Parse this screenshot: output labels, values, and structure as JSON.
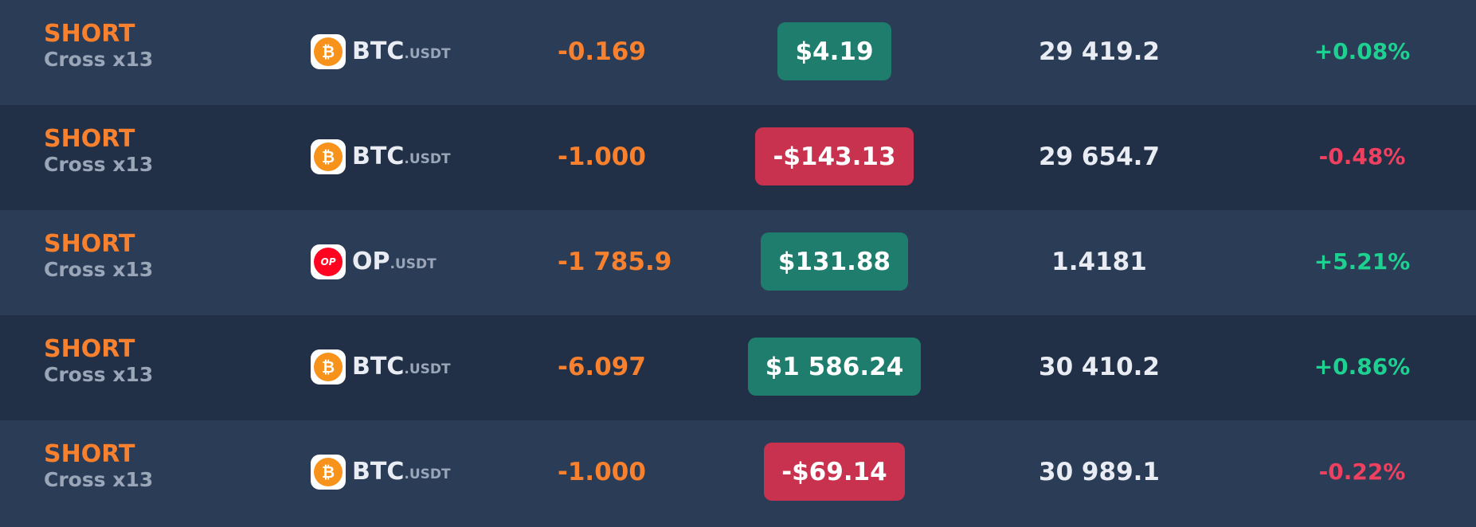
{
  "colors": {
    "short": "#f7812e",
    "positive_bg": "#1f7d6d",
    "negative_bg": "#c9324e",
    "positive_text": "#1dd190",
    "negative_text": "#f0405f",
    "btc_icon": "#f7931a",
    "op_icon": "#ff0420"
  },
  "positions": [
    {
      "side": "SHORT",
      "margin": "Cross x13",
      "icon": "btc-icon",
      "base": "BTC",
      "quote": ".USDT",
      "size": "-0.169",
      "pnl": "$4.19",
      "pnl_sign": "positive",
      "price": "29 419.2",
      "change": "+0.08%",
      "change_sign": "positive"
    },
    {
      "side": "SHORT",
      "margin": "Cross x13",
      "icon": "btc-icon",
      "base": "BTC",
      "quote": ".USDT",
      "size": "-1.000",
      "pnl": "-$143.13",
      "pnl_sign": "negative",
      "price": "29 654.7",
      "change": "-0.48%",
      "change_sign": "negative"
    },
    {
      "side": "SHORT",
      "margin": "Cross x13",
      "icon": "op-icon",
      "base": "OP",
      "quote": ".USDT",
      "size": "-1 785.9",
      "pnl": "$131.88",
      "pnl_sign": "positive",
      "price": "1.4181",
      "change": "+5.21%",
      "change_sign": "positive"
    },
    {
      "side": "SHORT",
      "margin": "Cross x13",
      "icon": "btc-icon",
      "base": "BTC",
      "quote": ".USDT",
      "size": "-6.097",
      "pnl": "$1 586.24",
      "pnl_sign": "positive",
      "price": "30 410.2",
      "change": "+0.86%",
      "change_sign": "positive"
    },
    {
      "side": "SHORT",
      "margin": "Cross x13",
      "icon": "btc-icon",
      "base": "BTC",
      "quote": ".USDT",
      "size": "-1.000",
      "pnl": "-$69.14",
      "pnl_sign": "negative",
      "price": "30 989.1",
      "change": "-0.22%",
      "change_sign": "negative"
    }
  ]
}
